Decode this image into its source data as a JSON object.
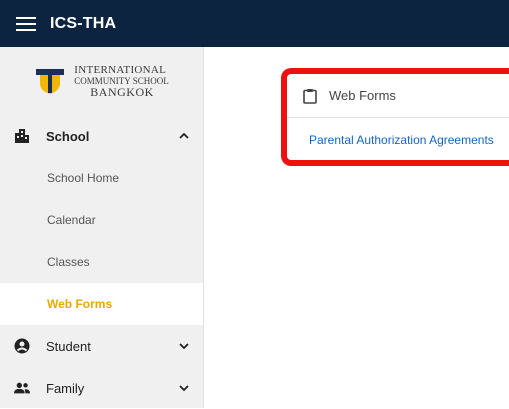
{
  "app": {
    "title": "ICS-THA"
  },
  "logo": {
    "line1": "INTERNATIONAL",
    "line2": "COMMUNITY SCHOOL",
    "line3": "BANGKOK"
  },
  "sidebar": {
    "school": {
      "label": "School",
      "expanded": true,
      "items": [
        {
          "label": "School Home"
        },
        {
          "label": "Calendar"
        },
        {
          "label": "Classes"
        },
        {
          "label": "Web Forms",
          "active": true
        }
      ]
    },
    "student": {
      "label": "Student"
    },
    "family": {
      "label": "Family"
    }
  },
  "card": {
    "title": "Web Forms",
    "link": "Parental Authorization Agreements"
  },
  "colors": {
    "topbar": "#0d2440",
    "accent": "#e8a800",
    "link": "#1565c0",
    "highlight": "#ee1111"
  }
}
